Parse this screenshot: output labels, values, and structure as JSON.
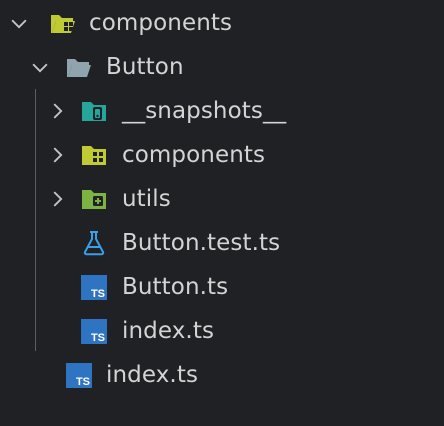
{
  "explorer": {
    "items": [
      {
        "label": "components",
        "icon": "folder-open-components-icon",
        "state": "expanded"
      },
      {
        "label": "Button",
        "icon": "folder-open-icon",
        "state": "expanded"
      },
      {
        "label": "__snapshots__",
        "icon": "folder-snapshots-icon",
        "state": "collapsed"
      },
      {
        "label": "components",
        "icon": "folder-components-icon",
        "state": "collapsed"
      },
      {
        "label": "utils",
        "icon": "folder-utils-icon",
        "state": "collapsed"
      },
      {
        "label": "Button.test.ts",
        "icon": "test-flask-icon"
      },
      {
        "label": "Button.ts",
        "icon": "typescript-file-icon"
      },
      {
        "label": "index.ts",
        "icon": "typescript-file-icon"
      },
      {
        "label": "index.ts",
        "icon": "typescript-file-icon"
      }
    ],
    "ts_icon_text": "TS"
  },
  "colors": {
    "background": "#1f2124",
    "text": "#d4d4d4",
    "chevron": "#c5c5c5",
    "ts_blue": "#2f74c0",
    "folder_yellow": "#c0ca33",
    "folder_teal": "#26a69a",
    "folder_green": "#7cb342",
    "flask_blue": "#3b9ee9"
  }
}
